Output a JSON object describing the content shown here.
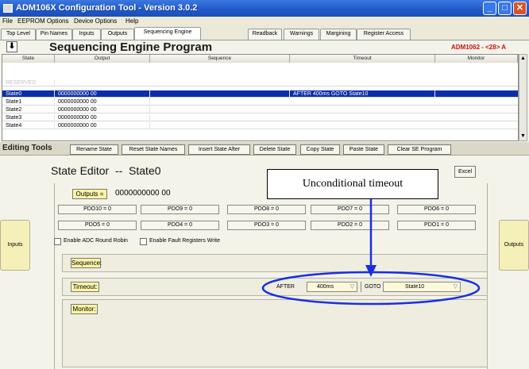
{
  "window": {
    "title": "ADM106X Configuration Tool -  Version 3.0.2",
    "icon": "app-icon",
    "controls": {
      "minimize": "_",
      "maximize": "□",
      "close": "✕"
    }
  },
  "menu": [
    "File",
    "EEPROM Options",
    "Device Options",
    "Help"
  ],
  "tabs": [
    "Top Level",
    "Pin Names",
    "Inputs",
    "Outputs",
    "Sequencing Engine",
    "Readback",
    "Warnings",
    "Margining",
    "Register Access"
  ],
  "active_tab": "Sequencing Engine",
  "header": {
    "title": "Sequencing Engine Program",
    "device": "ADM1062 - <28> A",
    "arrow_icon": "down-arrow-icon"
  },
  "table": {
    "columns": [
      "State",
      "Output",
      "Sequence",
      "Timeout",
      "Monitor"
    ],
    "rows": [
      {
        "state": "RESERVED",
        "output": "",
        "seq": "",
        "timeout": "",
        "monitor": ""
      },
      {
        "state": "State0",
        "output": "0000000000  00",
        "seq": "",
        "timeout": "AFTER  400ms GOTO State10",
        "monitor": ""
      },
      {
        "state": "State1",
        "output": "0000000000  00",
        "seq": "",
        "timeout": "",
        "monitor": ""
      },
      {
        "state": "State2",
        "output": "0000000000  00",
        "seq": "",
        "timeout": "",
        "monitor": ""
      },
      {
        "state": "State3",
        "output": "0000000000  00",
        "seq": "",
        "timeout": "",
        "monitor": ""
      },
      {
        "state": "State4",
        "output": "0000000000  00",
        "seq": "",
        "timeout": "",
        "monitor": ""
      }
    ],
    "scroll_up": "▲",
    "scroll_down": "▼"
  },
  "editing_tools": {
    "label": "Editing Tools",
    "buttons": [
      "Rename State",
      "Reset State Names",
      "Insert State After",
      "Delete State",
      "Copy State",
      "Paste State",
      "Clear SE Program"
    ]
  },
  "state_editor": {
    "title": "State Editor",
    "sep": "--",
    "state": "State0",
    "excel": "Excel",
    "callout": "Unconditional timeout",
    "outputs_btn": "Outputs =",
    "outputs_value": "0000000000  00",
    "pdo_row1": [
      "PDO10 = 0",
      "PDO9 = 0",
      "PDO8 = 0",
      "PDO7 = 0",
      "PDO6 = 0"
    ],
    "pdo_row2": [
      "PDO5 = 0",
      "PDO4 = 0",
      "PDO3 = 0",
      "PDO2 = 0",
      "PDO1 = 0"
    ],
    "chk_adc": "Enable ADC Round Robin",
    "chk_fault": "Enable Fault Registers Write",
    "inputs": "Inputs",
    "outputs": "Outputs",
    "sequence": "Sequence:",
    "timeout": "Timeout:",
    "monitor": "Monitor:",
    "after_label": "AFTER",
    "after_value": "400ms",
    "goto_label": "GOTO",
    "goto_value": "State10",
    "dd_arrow": "▽"
  },
  "colors": {
    "titlebar": "#2058c8",
    "selection": "#0a2ea8",
    "annotation": "#1a2ee0",
    "device_label": "#d01010",
    "yellow_button": "#fbf4a8"
  }
}
